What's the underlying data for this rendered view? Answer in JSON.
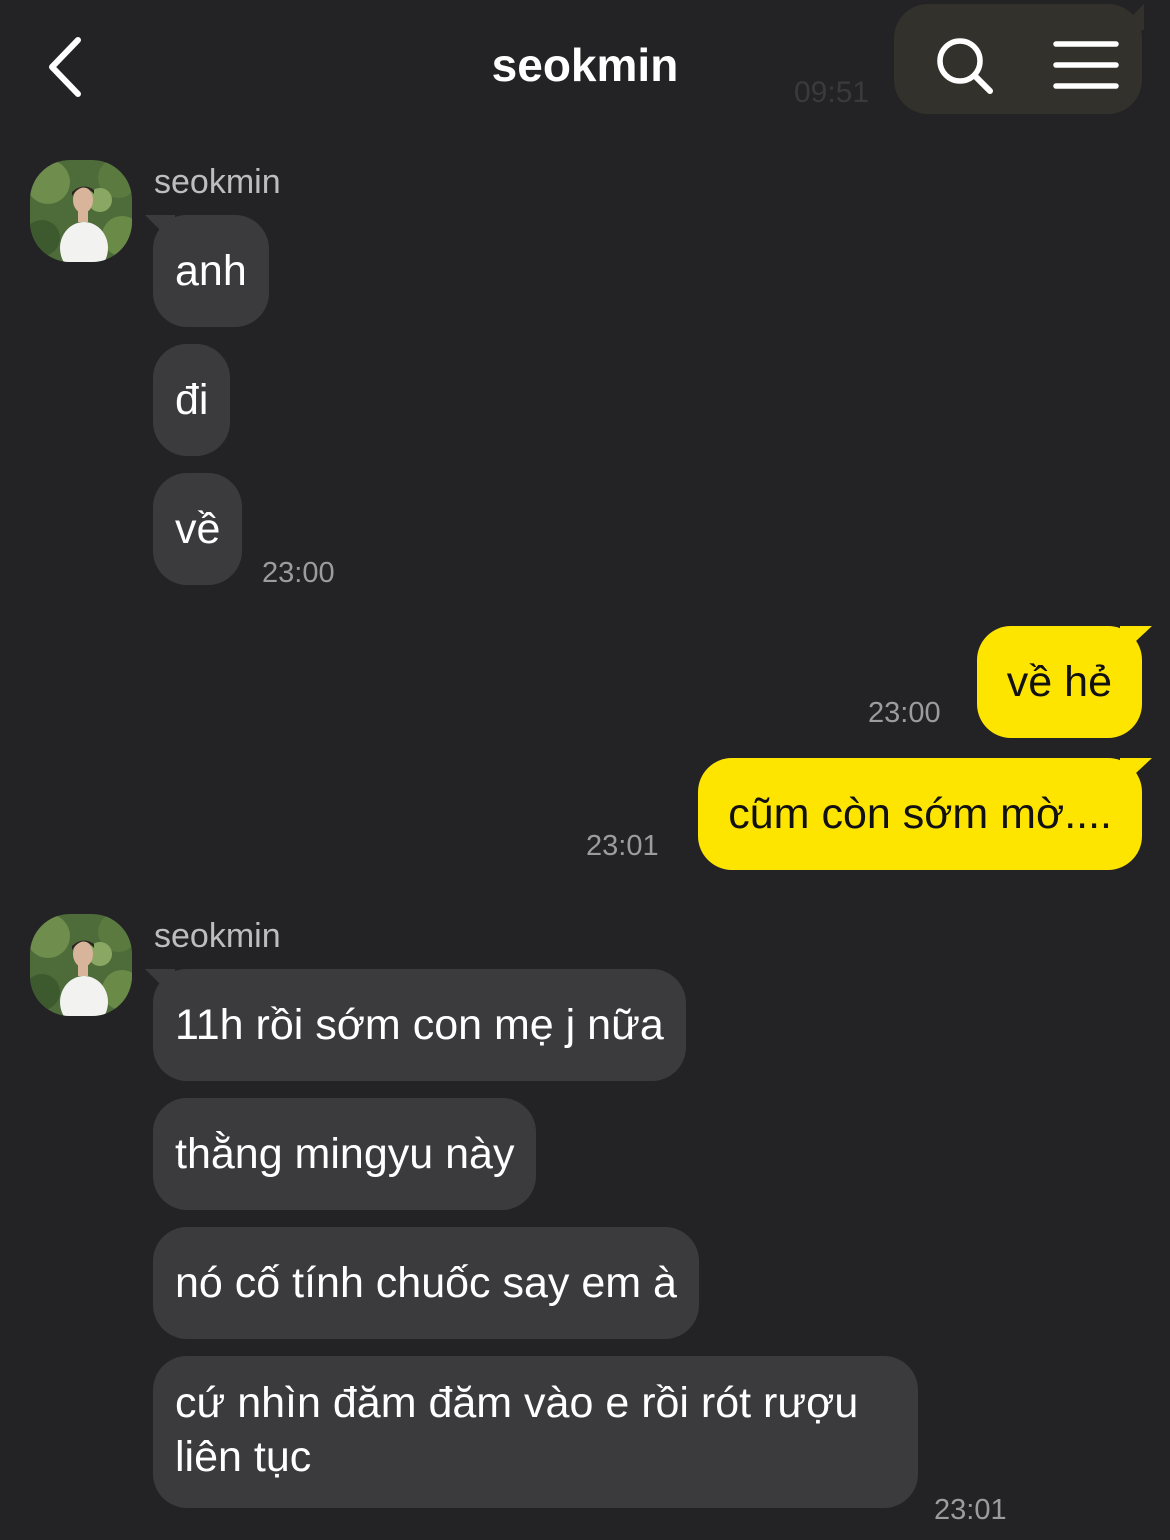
{
  "header": {
    "title": "seokmin",
    "background_time": "09:51"
  },
  "messages": {
    "group1": {
      "sender": "seokmin",
      "texts": [
        "anh",
        "đi",
        "về"
      ],
      "time": "23:00"
    },
    "sent": [
      {
        "text": "về hẻ",
        "time": "23:00"
      },
      {
        "text": "cũm còn sớm mờ....",
        "time": "23:01"
      }
    ],
    "group2": {
      "sender": "seokmin",
      "texts": [
        "11h rồi sớm con mẹ j nữa",
        "thằng mingyu này",
        "nó cố tính chuốc say em à",
        "cứ nhìn đăm đăm vào e rồi rót rượu liên tục"
      ],
      "time": "23:01"
    }
  },
  "colors": {
    "background": "#232325",
    "incoming_bubble": "#3b3b3e",
    "outgoing_bubble": "#fee500",
    "timestamp": "#9b9ba0"
  }
}
